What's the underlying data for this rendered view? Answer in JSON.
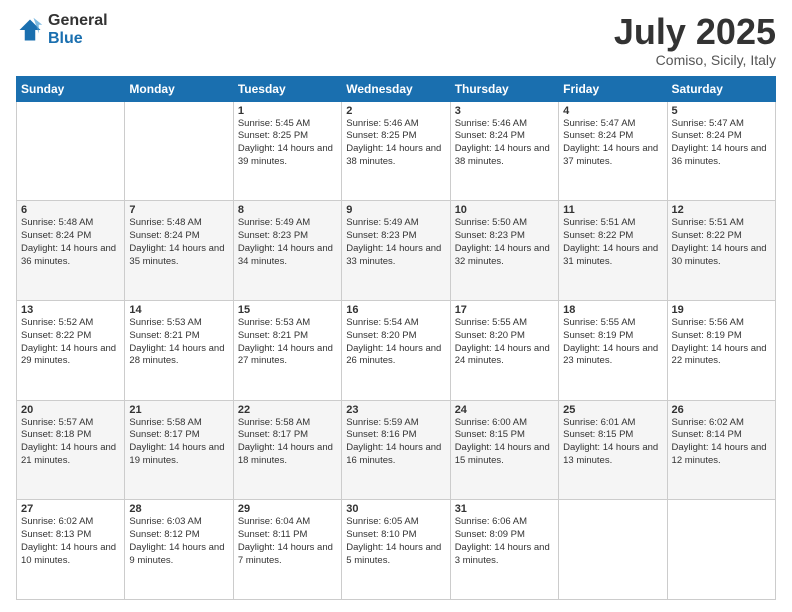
{
  "logo": {
    "general": "General",
    "blue": "Blue"
  },
  "header": {
    "month": "July 2025",
    "location": "Comiso, Sicily, Italy"
  },
  "weekdays": [
    "Sunday",
    "Monday",
    "Tuesday",
    "Wednesday",
    "Thursday",
    "Friday",
    "Saturday"
  ],
  "weeks": [
    [
      {
        "day": "",
        "info": ""
      },
      {
        "day": "",
        "info": ""
      },
      {
        "day": "1",
        "info": "Sunrise: 5:45 AM\nSunset: 8:25 PM\nDaylight: 14 hours and 39 minutes."
      },
      {
        "day": "2",
        "info": "Sunrise: 5:46 AM\nSunset: 8:25 PM\nDaylight: 14 hours and 38 minutes."
      },
      {
        "day": "3",
        "info": "Sunrise: 5:46 AM\nSunset: 8:24 PM\nDaylight: 14 hours and 38 minutes."
      },
      {
        "day": "4",
        "info": "Sunrise: 5:47 AM\nSunset: 8:24 PM\nDaylight: 14 hours and 37 minutes."
      },
      {
        "day": "5",
        "info": "Sunrise: 5:47 AM\nSunset: 8:24 PM\nDaylight: 14 hours and 36 minutes."
      }
    ],
    [
      {
        "day": "6",
        "info": "Sunrise: 5:48 AM\nSunset: 8:24 PM\nDaylight: 14 hours and 36 minutes."
      },
      {
        "day": "7",
        "info": "Sunrise: 5:48 AM\nSunset: 8:24 PM\nDaylight: 14 hours and 35 minutes."
      },
      {
        "day": "8",
        "info": "Sunrise: 5:49 AM\nSunset: 8:23 PM\nDaylight: 14 hours and 34 minutes."
      },
      {
        "day": "9",
        "info": "Sunrise: 5:49 AM\nSunset: 8:23 PM\nDaylight: 14 hours and 33 minutes."
      },
      {
        "day": "10",
        "info": "Sunrise: 5:50 AM\nSunset: 8:23 PM\nDaylight: 14 hours and 32 minutes."
      },
      {
        "day": "11",
        "info": "Sunrise: 5:51 AM\nSunset: 8:22 PM\nDaylight: 14 hours and 31 minutes."
      },
      {
        "day": "12",
        "info": "Sunrise: 5:51 AM\nSunset: 8:22 PM\nDaylight: 14 hours and 30 minutes."
      }
    ],
    [
      {
        "day": "13",
        "info": "Sunrise: 5:52 AM\nSunset: 8:22 PM\nDaylight: 14 hours and 29 minutes."
      },
      {
        "day": "14",
        "info": "Sunrise: 5:53 AM\nSunset: 8:21 PM\nDaylight: 14 hours and 28 minutes."
      },
      {
        "day": "15",
        "info": "Sunrise: 5:53 AM\nSunset: 8:21 PM\nDaylight: 14 hours and 27 minutes."
      },
      {
        "day": "16",
        "info": "Sunrise: 5:54 AM\nSunset: 8:20 PM\nDaylight: 14 hours and 26 minutes."
      },
      {
        "day": "17",
        "info": "Sunrise: 5:55 AM\nSunset: 8:20 PM\nDaylight: 14 hours and 24 minutes."
      },
      {
        "day": "18",
        "info": "Sunrise: 5:55 AM\nSunset: 8:19 PM\nDaylight: 14 hours and 23 minutes."
      },
      {
        "day": "19",
        "info": "Sunrise: 5:56 AM\nSunset: 8:19 PM\nDaylight: 14 hours and 22 minutes."
      }
    ],
    [
      {
        "day": "20",
        "info": "Sunrise: 5:57 AM\nSunset: 8:18 PM\nDaylight: 14 hours and 21 minutes."
      },
      {
        "day": "21",
        "info": "Sunrise: 5:58 AM\nSunset: 8:17 PM\nDaylight: 14 hours and 19 minutes."
      },
      {
        "day": "22",
        "info": "Sunrise: 5:58 AM\nSunset: 8:17 PM\nDaylight: 14 hours and 18 minutes."
      },
      {
        "day": "23",
        "info": "Sunrise: 5:59 AM\nSunset: 8:16 PM\nDaylight: 14 hours and 16 minutes."
      },
      {
        "day": "24",
        "info": "Sunrise: 6:00 AM\nSunset: 8:15 PM\nDaylight: 14 hours and 15 minutes."
      },
      {
        "day": "25",
        "info": "Sunrise: 6:01 AM\nSunset: 8:15 PM\nDaylight: 14 hours and 13 minutes."
      },
      {
        "day": "26",
        "info": "Sunrise: 6:02 AM\nSunset: 8:14 PM\nDaylight: 14 hours and 12 minutes."
      }
    ],
    [
      {
        "day": "27",
        "info": "Sunrise: 6:02 AM\nSunset: 8:13 PM\nDaylight: 14 hours and 10 minutes."
      },
      {
        "day": "28",
        "info": "Sunrise: 6:03 AM\nSunset: 8:12 PM\nDaylight: 14 hours and 9 minutes."
      },
      {
        "day": "29",
        "info": "Sunrise: 6:04 AM\nSunset: 8:11 PM\nDaylight: 14 hours and 7 minutes."
      },
      {
        "day": "30",
        "info": "Sunrise: 6:05 AM\nSunset: 8:10 PM\nDaylight: 14 hours and 5 minutes."
      },
      {
        "day": "31",
        "info": "Sunrise: 6:06 AM\nSunset: 8:09 PM\nDaylight: 14 hours and 3 minutes."
      },
      {
        "day": "",
        "info": ""
      },
      {
        "day": "",
        "info": ""
      }
    ]
  ]
}
